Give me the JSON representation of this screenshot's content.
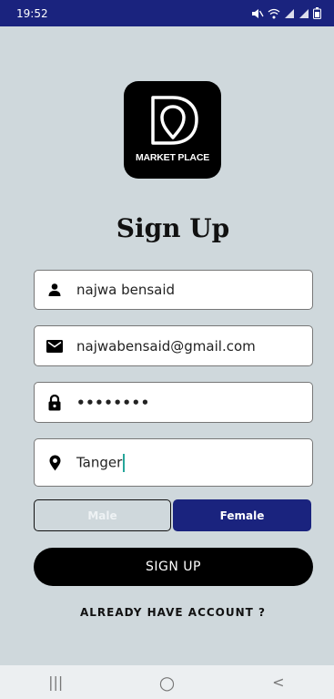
{
  "status_bar": {
    "time": "19:52",
    "background": "#1A237E",
    "icons": [
      "mute-icon",
      "wifi-icon",
      "signal-icon",
      "signal-icon",
      "battery-icon"
    ]
  },
  "logo": {
    "text": "MARKET PLACE",
    "icon": "map-pin-d-logo"
  },
  "title": "Sign Up",
  "form": {
    "name": {
      "icon": "person-icon",
      "value": "najwa bensaid"
    },
    "email": {
      "icon": "mail-icon",
      "value": "najwabensaid@gmail.com"
    },
    "password": {
      "icon": "lock-icon",
      "value": "••••••••"
    },
    "city": {
      "icon": "location-pin-icon",
      "value": "Tanger"
    }
  },
  "gender": {
    "male_label": "Male",
    "female_label": "Female",
    "selected": "Female",
    "accent": "#1A237E"
  },
  "signup_button_label": "SIGN UP",
  "already_have_account_label": "ALREADY HAVE ACCOUNT ?",
  "nav_bar": {
    "recents_glyph": "|||",
    "home_glyph": "○",
    "back_glyph": "<"
  }
}
